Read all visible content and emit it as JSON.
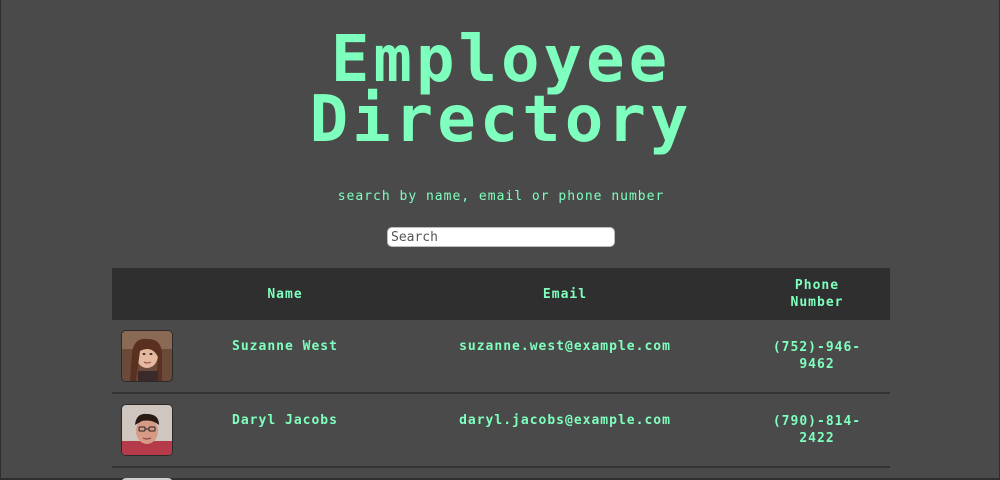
{
  "header": {
    "title_line1": "Employee",
    "title_line2": "Directory",
    "subtitle": "search by name, email or phone number"
  },
  "search": {
    "placeholder": "Search",
    "value": ""
  },
  "table": {
    "columns": {
      "image": "",
      "name": "Name",
      "email": "Email",
      "phone_line1": "Phone",
      "phone_line2": "Number"
    },
    "rows": [
      {
        "name": "Suzanne West",
        "email": "suzanne.west@example.com",
        "phone_line1": "(752)-946-",
        "phone_line2": "9462",
        "avatar_icon": "person-photo-icon"
      },
      {
        "name": "Daryl Jacobs",
        "email": "daryl.jacobs@example.com",
        "phone_line1": "(790)-814-",
        "phone_line2": "2422",
        "avatar_icon": "person-photo-icon"
      }
    ]
  },
  "colors": {
    "background": "#4a4a4a",
    "accent": "#7fffbe",
    "header_bg": "#2f2f2f"
  }
}
